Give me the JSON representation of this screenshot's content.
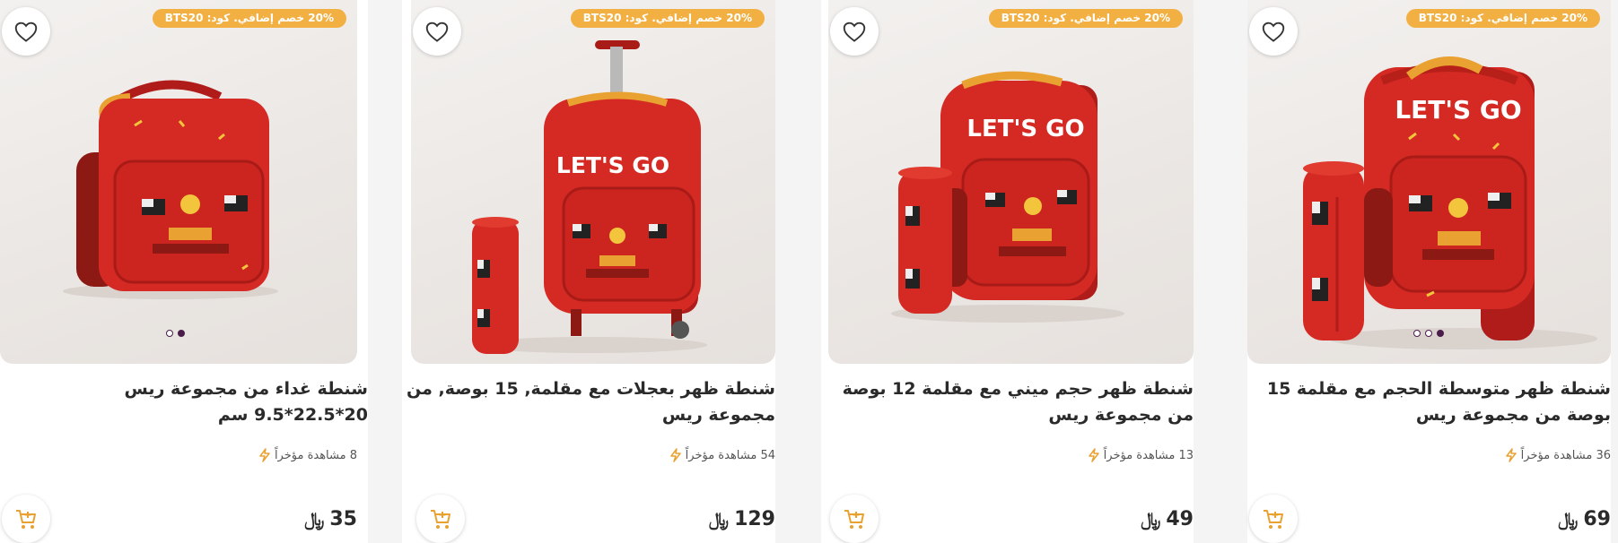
{
  "colors": {
    "promo_bg": "#f2b043",
    "bag_red": "#d42a23",
    "accent_orange": "#e9a131",
    "dot_active": "#4a1c4a"
  },
  "products": [
    {
      "promo": "20% خصم إضافي. كود: BTS20",
      "title": "شنطة ظهر متوسطة الحجم مع مقلمة 15 بوصة من مجموعة ريس",
      "views": "36 مشاهدة مؤخراً",
      "price": "69",
      "currency": "﷼",
      "image_label": "LET'S GO",
      "icons": {
        "wishlist": "heart-icon",
        "views": "lightning-icon",
        "cart": "add-to-cart-icon"
      },
      "carousel_dots": 3,
      "carousel_active": 2
    },
    {
      "promo": "20% خصم إضافي. كود: BTS20",
      "title": "شنطة ظهر حجم ميني مع مقلمة 12 بوصة من مجموعة ريس",
      "views": "13 مشاهدة مؤخراً",
      "price": "49",
      "currency": "﷼",
      "image_label": "LET'S GO",
      "icons": {
        "wishlist": "heart-icon",
        "views": "lightning-icon",
        "cart": "add-to-cart-icon"
      },
      "carousel_dots": 0,
      "carousel_active": 0
    },
    {
      "promo": "20% خصم إضافي. كود: BTS20",
      "title": "شنطة ظهر بعجلات مع مقلمة, 15 بوصة, من مجموعة ريس",
      "views": "54 مشاهدة مؤخراً",
      "price": "129",
      "currency": "﷼",
      "image_label": "LET'S GO",
      "icons": {
        "wishlist": "heart-icon",
        "views": "lightning-icon",
        "cart": "add-to-cart-icon"
      },
      "carousel_dots": 0,
      "carousel_active": 0
    },
    {
      "promo": "20% خصم إضافي. كود: BTS20",
      "title": "شنطة غداء من مجموعة ريس 20*22.5*9.5 سم",
      "views": "8 مشاهدة مؤخراً",
      "price": "35",
      "currency": "﷼",
      "image_label": "",
      "icons": {
        "wishlist": "heart-icon",
        "views": "lightning-icon",
        "cart": "add-to-cart-icon"
      },
      "carousel_dots": 2,
      "carousel_active": 1
    }
  ]
}
